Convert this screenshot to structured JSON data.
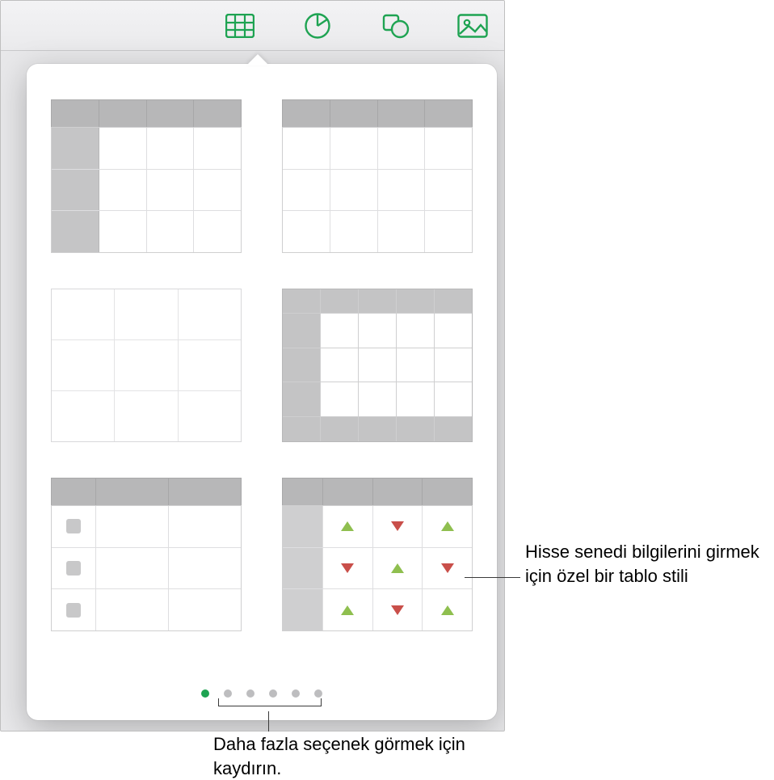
{
  "toolbar": {
    "items": [
      {
        "name": "table-icon",
        "selected": true
      },
      {
        "name": "chart-icon",
        "selected": false
      },
      {
        "name": "shape-icon",
        "selected": false
      },
      {
        "name": "media-icon",
        "selected": false
      }
    ]
  },
  "popover": {
    "page_count": 6,
    "active_page": 0,
    "styles": [
      {
        "id": "style-header-and-column"
      },
      {
        "id": "style-header-only"
      },
      {
        "id": "style-plain-grid"
      },
      {
        "id": "style-framed-header-footer"
      },
      {
        "id": "style-checklist"
      },
      {
        "id": "style-stock-arrows"
      }
    ],
    "stock_arrows": [
      [
        "up",
        "dn",
        "up"
      ],
      [
        "dn",
        "up",
        "dn"
      ],
      [
        "up",
        "dn",
        "up"
      ]
    ]
  },
  "callouts": {
    "stock_style": "Hisse senedi bilgilerini girmek için özel bir tablo stili",
    "swipe_hint": "Daha fazla seçenek görmek için kaydırın."
  },
  "colors": {
    "accent": "#1ea352",
    "arrow_up": "#8fbf4f",
    "arrow_down": "#c94f4a"
  }
}
